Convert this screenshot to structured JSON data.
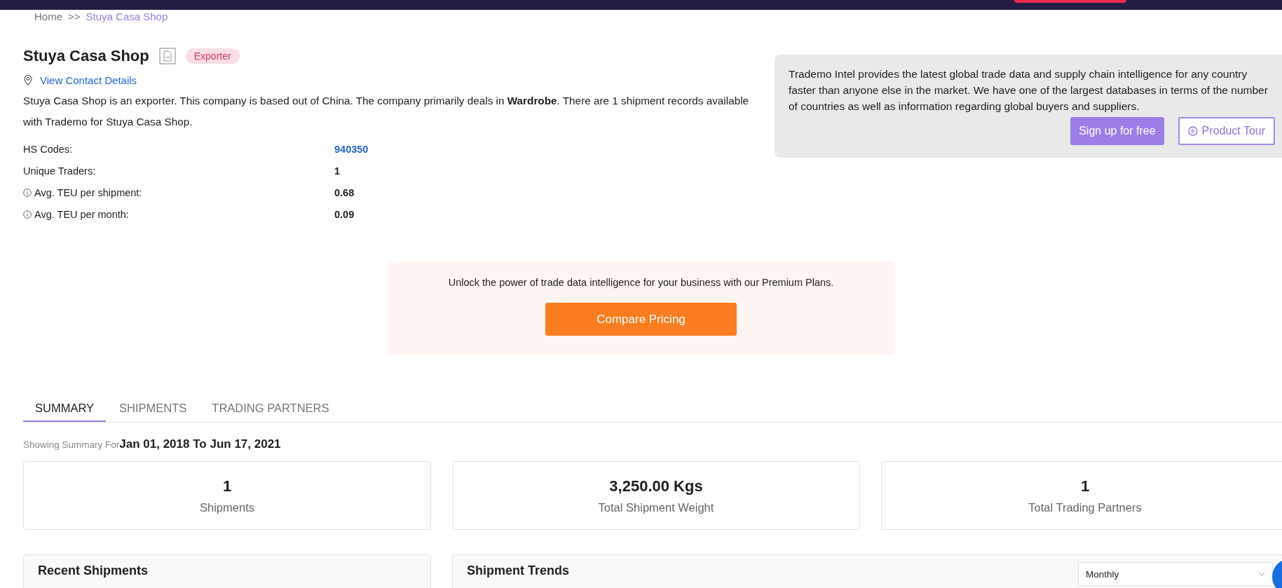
{
  "breadcrumb": {
    "separator": ">>",
    "items": [
      {
        "label": "Home",
        "selected": false
      },
      {
        "label": "Stuya Casa Shop",
        "selected": true
      }
    ]
  },
  "company": {
    "name": "Stuya Casa Shop",
    "badge": "Exporter",
    "contact_link": "View Contact Details",
    "description": "Stuya Casa Shop is an exporter. This company is based out of China. The company primarily deals in **Wardrobe**. There are 1 shipment records available with Trademo for Stuya Casa Shop.",
    "facts": [
      {
        "label": "HS Codes:",
        "value": "940350",
        "kind": "link",
        "info": false
      },
      {
        "label": "Unique Traders:",
        "value": "1",
        "kind": "text",
        "info": false
      },
      {
        "label": "Avg. TEU per shipment:",
        "value": "0.68",
        "kind": "text",
        "info": true
      },
      {
        "label": "Avg. TEU per month:",
        "value": "0.09",
        "kind": "text",
        "info": true
      }
    ]
  },
  "intel_panel": {
    "text": "Trademo Intel provides the latest global trade data and supply chain intelligence for any country faster than anyone else in the market. We have one of the largest databases in terms of the number of countries as well as information regarding global buyers and suppliers.",
    "buttons": [
      {
        "label": "Sign up for free",
        "kind": "primary"
      },
      {
        "label": "Product Tour",
        "kind": "outline"
      }
    ]
  },
  "premium": {
    "text": "Unlock the power of trade data intelligence for your business with our Premium Plans.",
    "button": "Compare Pricing"
  },
  "tabs": [
    {
      "label": "SUMMARY",
      "selected": true
    },
    {
      "label": "SHIPMENTS",
      "selected": false
    },
    {
      "label": "TRADING PARTNERS",
      "selected": false
    }
  ],
  "summary": {
    "prefix": "Showing Summary For",
    "range": "Jan 01, 2018 To Jun 17, 2021"
  },
  "stats": [
    {
      "value": "1",
      "label": "Shipments"
    },
    {
      "value": "3,250.00 Kgs",
      "label": "Total Shipment Weight"
    },
    {
      "value": "1",
      "label": "Total Trading Partners"
    }
  ],
  "panels": [
    {
      "title": "Recent Shipments"
    },
    {
      "title": "Shipment Trends",
      "select": "Monthly"
    }
  ]
}
